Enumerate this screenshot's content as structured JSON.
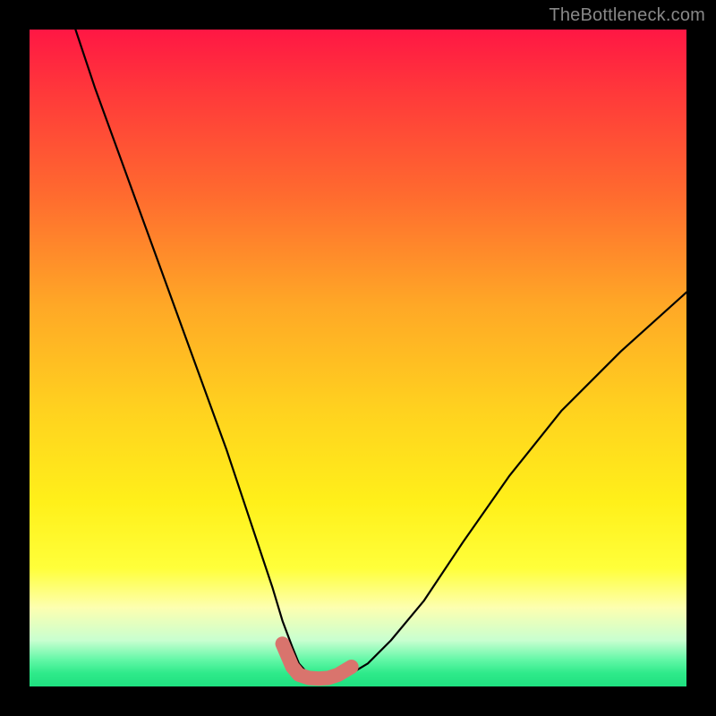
{
  "watermark": "TheBottleneck.com",
  "chart_data": {
    "type": "line",
    "title": "",
    "xlabel": "",
    "ylabel": "",
    "xlim": [
      0,
      100
    ],
    "ylim": [
      0,
      100
    ],
    "grid": false,
    "legend": false,
    "series": [
      {
        "name": "bottleneck-curve",
        "color": "#000000",
        "x": [
          7,
          10,
          14,
          18,
          22,
          26,
          30,
          33,
          35,
          37,
          38.5,
          40,
          41,
          42.5,
          44,
          45.5,
          47,
          49,
          51.5,
          55,
          60,
          66,
          73,
          81,
          90,
          100
        ],
        "y": [
          100,
          91,
          80,
          69,
          58,
          47,
          36,
          27,
          21,
          15,
          10,
          6,
          3.5,
          1.8,
          1.2,
          1.0,
          1.3,
          2.0,
          3.5,
          7,
          13,
          22,
          32,
          42,
          51,
          60
        ]
      },
      {
        "name": "optimal-range-marker",
        "color": "#d9746d",
        "x": [
          38.5,
          40,
          41,
          42.5,
          44,
          45.5,
          47,
          49
        ],
        "y": [
          6.5,
          3.0,
          1.8,
          1.3,
          1.2,
          1.3,
          1.8,
          3.0
        ]
      }
    ],
    "gradient_stops": [
      {
        "pos": 0,
        "color": "#ff1744"
      },
      {
        "pos": 10,
        "color": "#ff3a3a"
      },
      {
        "pos": 25,
        "color": "#ff6a2f"
      },
      {
        "pos": 42,
        "color": "#ffa826"
      },
      {
        "pos": 58,
        "color": "#ffd21f"
      },
      {
        "pos": 72,
        "color": "#fff01a"
      },
      {
        "pos": 82,
        "color": "#ffff3a"
      },
      {
        "pos": 88,
        "color": "#fdffb0"
      },
      {
        "pos": 93,
        "color": "#c8ffd0"
      },
      {
        "pos": 96,
        "color": "#61f7a6"
      },
      {
        "pos": 98,
        "color": "#2eea8a"
      },
      {
        "pos": 100,
        "color": "#1fe080"
      }
    ]
  }
}
